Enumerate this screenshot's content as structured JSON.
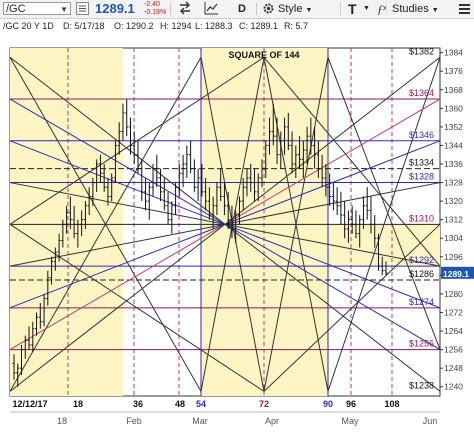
{
  "toolbar": {
    "symbol": "/GC",
    "price": "1289.1",
    "change_abs": "-2.40",
    "change_pct": "-0.19%",
    "interval_label": "D",
    "style_label": "Style",
    "studies_label": "Studies",
    "text_tool_label": "T"
  },
  "info": {
    "title": "/GC 20 Y 1D",
    "date": "D: 5/17/18",
    "open": "O: 1290.2",
    "high": "H: 1294",
    "low": "L: 1288.3",
    "close": "C: 1289.1",
    "range": "R: 5.7"
  },
  "colors": {
    "price_tag": "#1c57b8",
    "grid_purple": "#8a1a5a",
    "grid_blue": "#2a2ab8",
    "panel_yellow": "#fdf6c4"
  },
  "chart_data": {
    "type": "candlestick",
    "overlay_title": "SQUARE OF 144",
    "ylim": [
      1236,
      1386
    ],
    "y_ticks": [
      1240,
      1248,
      1256,
      1264,
      1272,
      1280,
      1288,
      1296,
      1304,
      1312,
      1320,
      1328,
      1336,
      1344,
      1352,
      1360,
      1368,
      1376,
      1384
    ],
    "price_level_labels": [
      "$1382",
      "$1364",
      "$1346",
      "$1334",
      "$1328",
      "$1310",
      "$1292",
      "$1286",
      "$1274",
      "$1256",
      "$1238"
    ],
    "bar_count_labels": [
      "12/12/17",
      "18",
      "36",
      "48",
      "54",
      "72",
      "90",
      "96",
      "108"
    ],
    "month_labels": [
      "18",
      "Feb",
      "Mar",
      "Apr",
      "May",
      "Jun"
    ],
    "last_price": "1289.1",
    "ohlc": [
      [
        1250,
        1254,
        1243,
        1246
      ],
      [
        1246,
        1250,
        1240,
        1248
      ],
      [
        1248,
        1258,
        1245,
        1256
      ],
      [
        1256,
        1262,
        1252,
        1260
      ],
      [
        1260,
        1266,
        1256,
        1258
      ],
      [
        1258,
        1268,
        1255,
        1265
      ],
      [
        1265,
        1272,
        1262,
        1270
      ],
      [
        1270,
        1276,
        1265,
        1268
      ],
      [
        1268,
        1280,
        1266,
        1278
      ],
      [
        1278,
        1290,
        1275,
        1287
      ],
      [
        1287,
        1296,
        1284,
        1294
      ],
      [
        1294,
        1300,
        1290,
        1298
      ],
      [
        1298,
        1306,
        1294,
        1303
      ],
      [
        1303,
        1312,
        1300,
        1310
      ],
      [
        1310,
        1318,
        1306,
        1315
      ],
      [
        1315,
        1322,
        1308,
        1312
      ],
      [
        1312,
        1318,
        1304,
        1306
      ],
      [
        1306,
        1312,
        1300,
        1310
      ],
      [
        1310,
        1316,
        1305,
        1312
      ],
      [
        1312,
        1320,
        1308,
        1318
      ],
      [
        1318,
        1326,
        1314,
        1322
      ],
      [
        1322,
        1330,
        1318,
        1328
      ],
      [
        1328,
        1338,
        1324,
        1336
      ],
      [
        1336,
        1340,
        1328,
        1332
      ],
      [
        1332,
        1336,
        1324,
        1326
      ],
      [
        1326,
        1330,
        1318,
        1322
      ],
      [
        1322,
        1332,
        1320,
        1330
      ],
      [
        1330,
        1346,
        1328,
        1344
      ],
      [
        1344,
        1354,
        1340,
        1350
      ],
      [
        1350,
        1362,
        1346,
        1358
      ],
      [
        1358,
        1364,
        1348,
        1352
      ],
      [
        1352,
        1356,
        1340,
        1344
      ],
      [
        1344,
        1350,
        1336,
        1340
      ],
      [
        1340,
        1346,
        1332,
        1334
      ],
      [
        1334,
        1338,
        1320,
        1324
      ],
      [
        1324,
        1330,
        1316,
        1320
      ],
      [
        1320,
        1328,
        1312,
        1326
      ],
      [
        1326,
        1336,
        1322,
        1334
      ],
      [
        1334,
        1340,
        1326,
        1330
      ],
      [
        1330,
        1334,
        1320,
        1324
      ],
      [
        1324,
        1330,
        1316,
        1318
      ],
      [
        1318,
        1324,
        1310,
        1312
      ],
      [
        1312,
        1320,
        1306,
        1318
      ],
      [
        1318,
        1328,
        1314,
        1326
      ],
      [
        1326,
        1336,
        1322,
        1332
      ],
      [
        1332,
        1340,
        1326,
        1336
      ],
      [
        1336,
        1344,
        1330,
        1340
      ],
      [
        1340,
        1346,
        1332,
        1334
      ],
      [
        1334,
        1338,
        1324,
        1326
      ],
      [
        1326,
        1334,
        1320,
        1330
      ],
      [
        1330,
        1336,
        1322,
        1324
      ],
      [
        1324,
        1330,
        1316,
        1320
      ],
      [
        1320,
        1326,
        1312,
        1314
      ],
      [
        1314,
        1322,
        1308,
        1318
      ],
      [
        1318,
        1328,
        1314,
        1326
      ],
      [
        1326,
        1334,
        1320,
        1322
      ],
      [
        1322,
        1328,
        1314,
        1318
      ],
      [
        1318,
        1324,
        1308,
        1312
      ],
      [
        1312,
        1318,
        1304,
        1308
      ],
      [
        1308,
        1316,
        1302,
        1314
      ],
      [
        1314,
        1322,
        1310,
        1320
      ],
      [
        1320,
        1330,
        1316,
        1326
      ],
      [
        1326,
        1334,
        1322,
        1330
      ],
      [
        1330,
        1336,
        1324,
        1328
      ],
      [
        1328,
        1334,
        1320,
        1324
      ],
      [
        1324,
        1332,
        1320,
        1330
      ],
      [
        1330,
        1338,
        1326,
        1334
      ],
      [
        1334,
        1346,
        1330,
        1344
      ],
      [
        1344,
        1356,
        1340,
        1350
      ],
      [
        1350,
        1362,
        1344,
        1348
      ],
      [
        1348,
        1356,
        1336,
        1340
      ],
      [
        1340,
        1350,
        1334,
        1346
      ],
      [
        1346,
        1356,
        1340,
        1352
      ],
      [
        1352,
        1358,
        1342,
        1344
      ],
      [
        1344,
        1350,
        1332,
        1336
      ],
      [
        1336,
        1344,
        1330,
        1340
      ],
      [
        1340,
        1348,
        1334,
        1338
      ],
      [
        1338,
        1346,
        1330,
        1342
      ],
      [
        1342,
        1352,
        1336,
        1348
      ],
      [
        1348,
        1356,
        1340,
        1344
      ],
      [
        1344,
        1352,
        1334,
        1340
      ],
      [
        1340,
        1346,
        1330,
        1334
      ],
      [
        1334,
        1340,
        1326,
        1330
      ],
      [
        1330,
        1336,
        1322,
        1326
      ],
      [
        1326,
        1332,
        1318,
        1322
      ],
      [
        1322,
        1328,
        1316,
        1320
      ],
      [
        1320,
        1326,
        1314,
        1318
      ],
      [
        1318,
        1324,
        1310,
        1314
      ],
      [
        1314,
        1320,
        1304,
        1308
      ],
      [
        1308,
        1316,
        1302,
        1312
      ],
      [
        1312,
        1318,
        1306,
        1310
      ],
      [
        1310,
        1316,
        1304,
        1306
      ],
      [
        1306,
        1314,
        1300,
        1312
      ],
      [
        1312,
        1322,
        1308,
        1318
      ],
      [
        1318,
        1326,
        1312,
        1316
      ],
      [
        1316,
        1322,
        1306,
        1310
      ],
      [
        1310,
        1314,
        1300,
        1304
      ],
      [
        1304,
        1306,
        1290,
        1292
      ],
      [
        1292,
        1296,
        1288,
        1290
      ],
      [
        1290,
        1294,
        1288,
        1289
      ]
    ]
  }
}
